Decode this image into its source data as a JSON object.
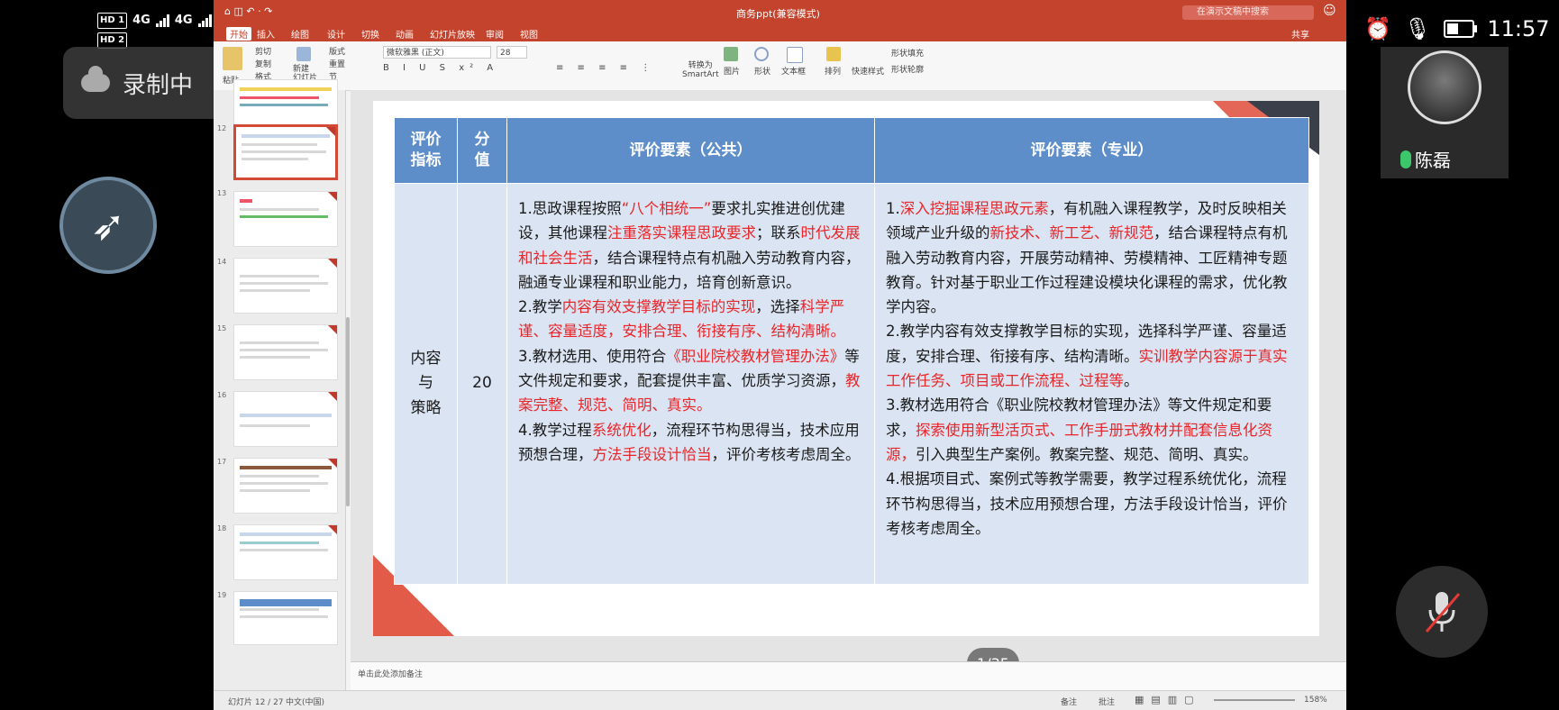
{
  "phone_status": {
    "hd1": "HD 1",
    "hd2": "HD 2",
    "net1": "4G",
    "net2": "4G",
    "time": "11:57"
  },
  "recording": {
    "label": "录制中"
  },
  "app": {
    "title": "商务ppt(兼容模式)",
    "search_placeholder": "在演示文稿中搜索",
    "menu": [
      "开始",
      "插入",
      "绘图",
      "设计",
      "切换",
      "动画",
      "幻灯片放映",
      "审阅",
      "视图"
    ],
    "share": "共享",
    "ribbon": {
      "paste": "粘贴",
      "cut": "剪切",
      "copy": "复制",
      "format": "格式",
      "new_slide": "新建\n幻灯片",
      "layout": "版式",
      "reset": "重置",
      "section": "节",
      "font": "微软雅黑 (正文)",
      "size": "28",
      "convert_smartart": "转换为\nSmartArt",
      "picture": "图片",
      "shape": "形状",
      "textbox": "文本框",
      "arrange": "排列",
      "quick_styles": "快速样式",
      "shape_fill": "形状填充",
      "shape_outline": "形状轮廓"
    },
    "thumb_numbers": [
      "12",
      "13",
      "14",
      "15",
      "16",
      "17",
      "18",
      "19"
    ],
    "notes_placeholder": "单击此处添加备注",
    "status": {
      "slide_info": "幻灯片 12 / 27",
      "language": "中文(中国)",
      "notes": "备注",
      "comments": "批注",
      "zoom": "158%"
    }
  },
  "slide": {
    "headers": [
      "评价\n指标",
      "分\n值",
      "评价要素（公共）",
      "评价要素（专业）"
    ],
    "row_label": "内容\n与\n策略",
    "score": "20",
    "public": [
      [
        {
          "t": "1.思政课程按照"
        },
        {
          "t": "“八个相统一”",
          "r": true
        },
        {
          "t": "要求扎实推进创优建设，其他课程"
        },
        {
          "t": "注重落实课程思政要求",
          "r": true
        },
        {
          "t": "；联系"
        },
        {
          "t": "时代发展和社会生活",
          "r": true
        },
        {
          "t": "，结合课程特点有机融入劳动教育内容，融通专业课程和职业能力，培育创新意识。"
        }
      ],
      [
        {
          "t": "2.教学"
        },
        {
          "t": "内容有效支撑教学目标的实现",
          "r": true
        },
        {
          "t": "，选择"
        },
        {
          "t": "科学严谨、容量适度，安排合理、衔接有序、结构清晰。",
          "r": true
        }
      ],
      [
        {
          "t": "3.教材选用、使用符合"
        },
        {
          "t": "《职业院校教材管理办法》",
          "r": true
        },
        {
          "t": "等文件规定和要求，配套提供丰富、优质学习资源，"
        },
        {
          "t": "教案完整、规范、简明、真实。",
          "r": true
        }
      ],
      [
        {
          "t": "4.教学过程"
        },
        {
          "t": "系统优化",
          "r": true
        },
        {
          "t": "，流程环节构思得当，技术应用预想合理，"
        },
        {
          "t": "方法手段设计恰当",
          "r": true
        },
        {
          "t": "，评价考核考虑周全。"
        }
      ]
    ],
    "professional": [
      [
        {
          "t": "1."
        },
        {
          "t": "深入挖掘课程思政元素",
          "r": true
        },
        {
          "t": "，有机融入课程教学，及时反映相关领域产业升级的"
        },
        {
          "t": "新技术、新工艺、新规范",
          "r": true
        },
        {
          "t": "，结合课程特点有机融入劳动教育内容，开展劳动精神、劳模精神、工匠精神专题教育。针对基于职业工作过程建设模块化课程的需求，优化教学内容。"
        }
      ],
      [
        {
          "t": "2.教学内容有效支撑教学目标的实现，选择科学严谨、容量适度，安排合理、衔接有序、结构清晰。"
        },
        {
          "t": "实训教学内容源于真实工作任务、项目或工作流程、过程等",
          "r": true
        },
        {
          "t": "。"
        }
      ],
      [
        {
          "t": "3.教材选用符合《职业院校教材管理办法》等文件规定和要求，"
        },
        {
          "t": "探索使用新型活页式、工作手册式教材并配套信息化资源，",
          "r": true
        },
        {
          "t": "引入典型生产案例。教案完整、规范、简明、真实。"
        }
      ],
      [
        {
          "t": "4.根据项目式、案例式等教学需要，教学过程系统优化，流程环节构思得当，技术应用预想合理，方法手段设计恰当，评价考核考虑周全。"
        }
      ]
    ]
  },
  "page_indicator": "1/35",
  "video": {
    "name": "陈磊"
  },
  "colors": {
    "accent_red": "#e8262a",
    "header_blue": "#5d8ec9",
    "cell_blue": "#dbe4f2",
    "titlebar": "#c4432c"
  },
  "icons": [
    "cloud-icon",
    "dingtalk-logo-icon",
    "alarm-icon",
    "mic-icon",
    "battery-icon",
    "mic-muted-icon"
  ]
}
